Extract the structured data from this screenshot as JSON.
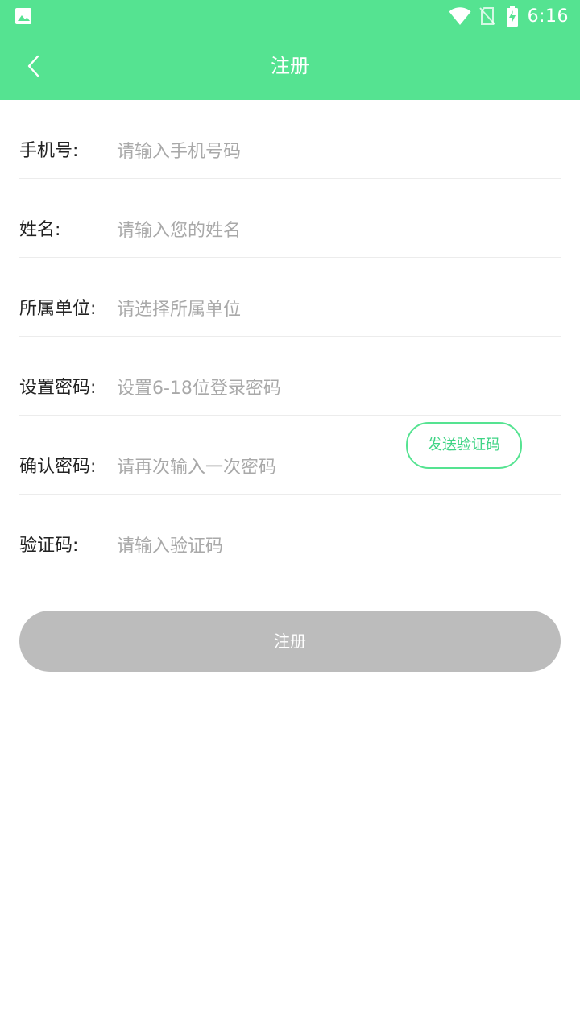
{
  "status_bar": {
    "time": "6:16",
    "icons": [
      "gallery-icon",
      "wifi-icon",
      "no-sim-icon",
      "battery-charging-icon"
    ]
  },
  "toolbar": {
    "title": "注册",
    "back_icon": "chevron-left-icon"
  },
  "colors": {
    "brand": "#55e391",
    "accent_text": "#3fd485",
    "disabled_button": "#bcbcbc",
    "divider": "#ececec",
    "placeholder": "#a9a9a9"
  },
  "form": {
    "phone": {
      "label": "手机号:",
      "placeholder": "请输入手机号码",
      "value": ""
    },
    "name": {
      "label": "姓名:",
      "placeholder": "请输入您的姓名",
      "value": ""
    },
    "unit": {
      "label": "所属单位:",
      "placeholder": "请选择所属单位",
      "value": ""
    },
    "password": {
      "label": "设置密码:",
      "placeholder": "设置6-18位登录密码",
      "value": ""
    },
    "confirm_password": {
      "label": "确认密码:",
      "placeholder": "请再次输入一次密码",
      "value": ""
    },
    "code": {
      "label": "验证码:",
      "placeholder": "请输入验证码",
      "value": ""
    },
    "send_code_label": "发送验证码",
    "submit_label": "注册"
  }
}
